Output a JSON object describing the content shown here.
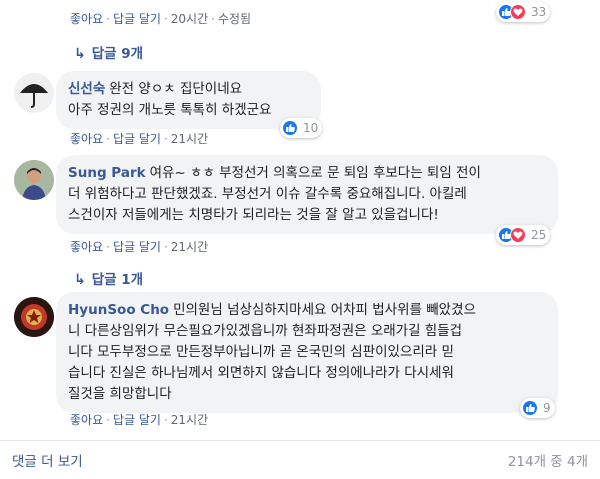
{
  "colors": {
    "link": "#385898",
    "bubble": "#f2f3f5",
    "like_blue": "#1877f2",
    "love_red": "#f33e58"
  },
  "top_comment": {
    "actions": {
      "like": "좋아요",
      "reply": "답글 달기",
      "time": "20시간",
      "edited": "수정됨"
    },
    "reaction_count": "33",
    "replies_toggle": "답글 9개"
  },
  "comments": [
    {
      "author": "신선숙",
      "lines": [
        "완전 양ㅇㅊ 집단이네요",
        "아주 정권의 개노릇 톡톡히 하겠군요"
      ],
      "actions": {
        "like": "좋아요",
        "reply": "답글 달기",
        "time": "21시간"
      },
      "reaction_count": "10",
      "avatar_icon": "umbrella-icon"
    },
    {
      "author": "Sung Park",
      "lines": [
        "여유~ ㅎㅎ 부정선거 의혹으로 문 퇴임 후보다는 퇴임 전이",
        "더 위험하다고 판단했겠죠. 부정선거 이슈 갈수록 중요해집니다. 아킬레",
        "스건이자 저들에게는 치명타가 되리라는 것을 잘 알고 있을겁니다!"
      ],
      "actions": {
        "like": "좋아요",
        "reply": "답글 달기",
        "time": "21시간"
      },
      "reaction_count": "25",
      "replies_toggle": "답글 1개"
    },
    {
      "author": "HyunSoo Cho",
      "lines": [
        "민의원님 넘상심하지마세요 어차피 법사위를 빼았겼으",
        "니 다른상임위가 무슨필요가있겠읍니까 현좌파정권은 오래가길 힘들겁",
        "니다 모두부정으로 만든정부아닙니까 곧 온국민의 심판이있으리라 믿",
        "습니다 진실은 하나님께서 외면하지 않습니다 정의에나라가 다시세워",
        "질것을 희망합니다"
      ],
      "actions": {
        "like": "좋아요",
        "reply": "답글 달기",
        "time": "21시간"
      },
      "reaction_count": "9"
    }
  ],
  "footer": {
    "more_comments": "댓글 더 보기",
    "pagination": "214개 중 4개"
  }
}
